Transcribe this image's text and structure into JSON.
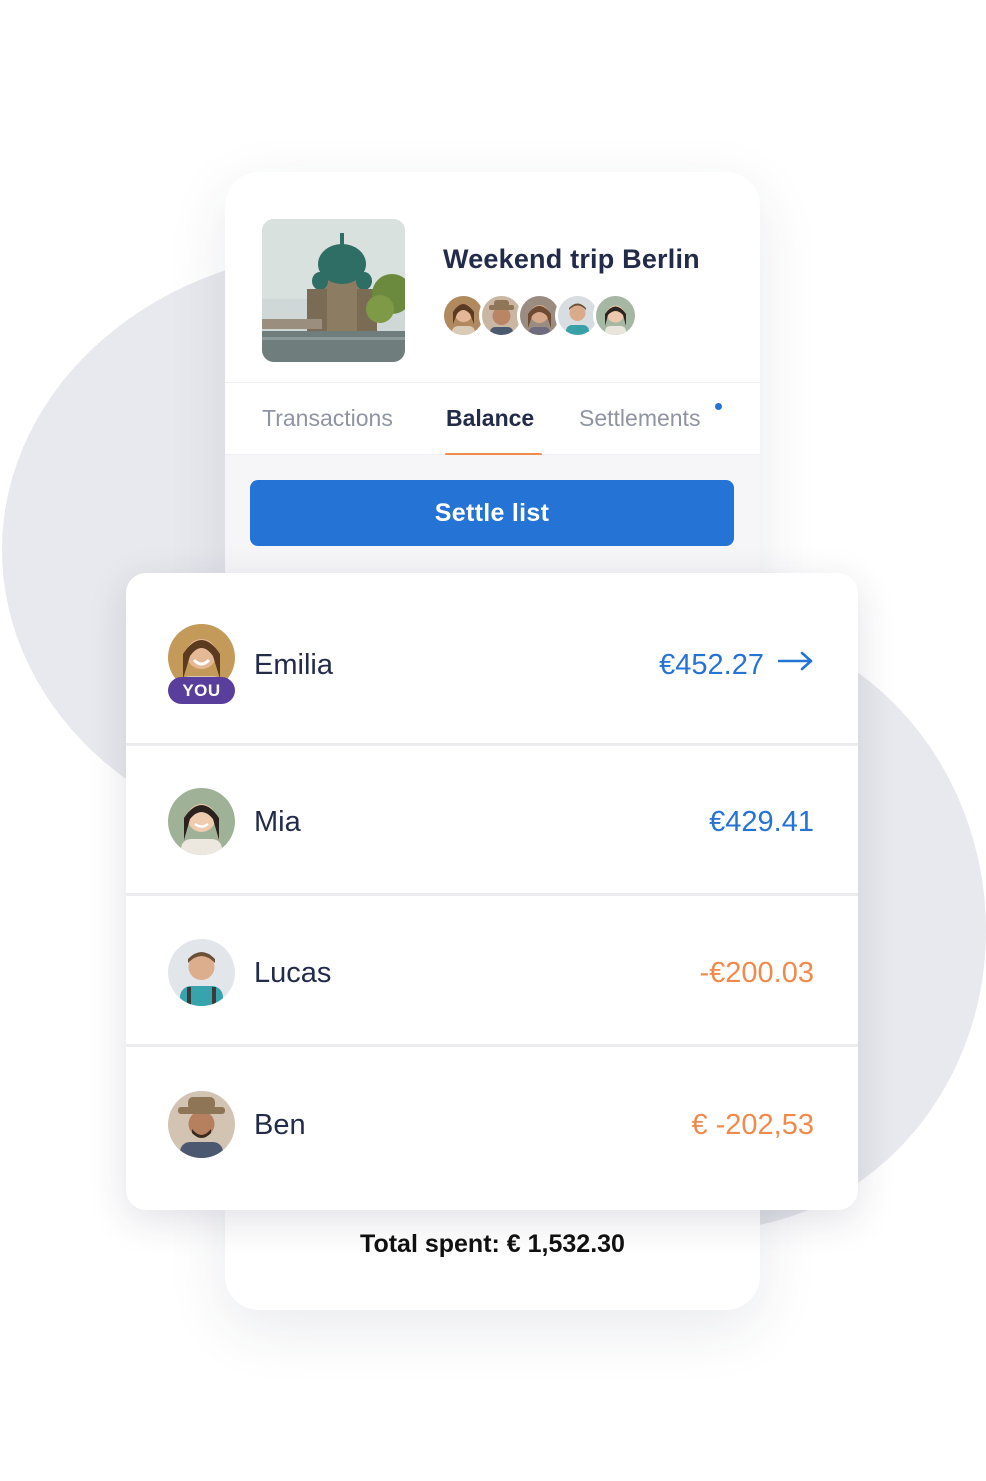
{
  "trip": {
    "title": "Weekend trip Berlin",
    "members": [
      "Emilia",
      "Ben",
      "Member",
      "Lucas",
      "Mia"
    ]
  },
  "tabs": [
    {
      "label": "Transactions",
      "active": false
    },
    {
      "label": "Balance",
      "active": true
    },
    {
      "label": "Settlements",
      "active": false,
      "has_notification": true
    }
  ],
  "actions": {
    "settle_label": "Settle list"
  },
  "balances": [
    {
      "name": "Emilia",
      "amount": "€452.27",
      "is_you": true,
      "badge": "YOU",
      "sign": "positive"
    },
    {
      "name": "Mia",
      "amount": "€429.41",
      "sign": "positive"
    },
    {
      "name": "Lucas",
      "amount": "-€200.03",
      "sign": "negative"
    },
    {
      "name": "Ben",
      "amount": "€ -202,53",
      "sign": "negative"
    }
  ],
  "total": "Total spent: € 1,532.30",
  "colors": {
    "accent": "#2573d5",
    "negative": "#f08a4b",
    "tab_underline": "#f08a4b",
    "you_badge": "#5a3e9c",
    "text": "#232b4a"
  }
}
